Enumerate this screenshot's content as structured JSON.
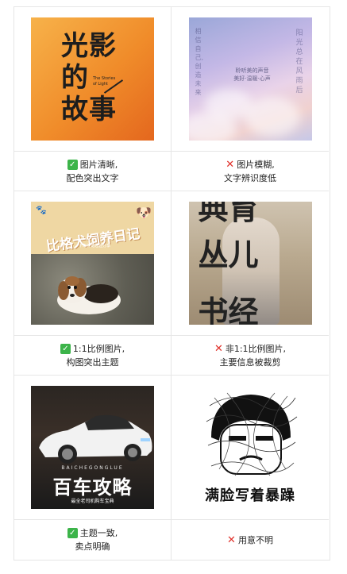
{
  "rows": [
    {
      "left": {
        "image": {
          "title_chars": [
            "光影",
            "的",
            "故事"
          ],
          "subtitle": "The Stories of Light"
        },
        "status": "ok",
        "caption_line1": "图片清晰,",
        "caption_line2": "配色突出文字"
      },
      "right": {
        "image": {
          "left_vertical": "相信自己,创造未来",
          "right_vertical": "阳光总在风雨后",
          "center_line1": "聆听美的声音",
          "center_line2": "美好·温暖·心声"
        },
        "status": "bad",
        "caption_line1": "图片模糊,",
        "caption_line2": "文字辨识度低"
      }
    },
    {
      "left": {
        "image": {
          "title": "比格犬饲养日记",
          "subtitle": "十年养宠经验分享"
        },
        "status": "ok",
        "caption_line1": "1:1比例图片,",
        "caption_line2": "构图突出主题"
      },
      "right": {
        "image": {
          "chars_top": "典育",
          "chars_mid": "丛儿",
          "chars_bottom": "书经"
        },
        "status": "bad",
        "caption_line1": "非1:1比例图片,",
        "caption_line2": "主要信息被裁剪"
      }
    },
    {
      "left": {
        "image": {
          "brand": "BAICHEGONGLUE",
          "title": "百车攻略",
          "subtitle": "最全老司机购车宝典"
        },
        "status": "ok",
        "caption_line1": "主题一致,",
        "caption_line2": "卖点明确"
      },
      "right": {
        "image": {
          "caption": "满脸写着暴躁"
        },
        "status": "bad",
        "caption_line1": "用意不明",
        "caption_line2": ""
      }
    }
  ],
  "icons": {
    "ok": "check-mark",
    "bad": "cross-mark",
    "ok_color": "#3cb44a",
    "bad_color": "#e0302a"
  }
}
